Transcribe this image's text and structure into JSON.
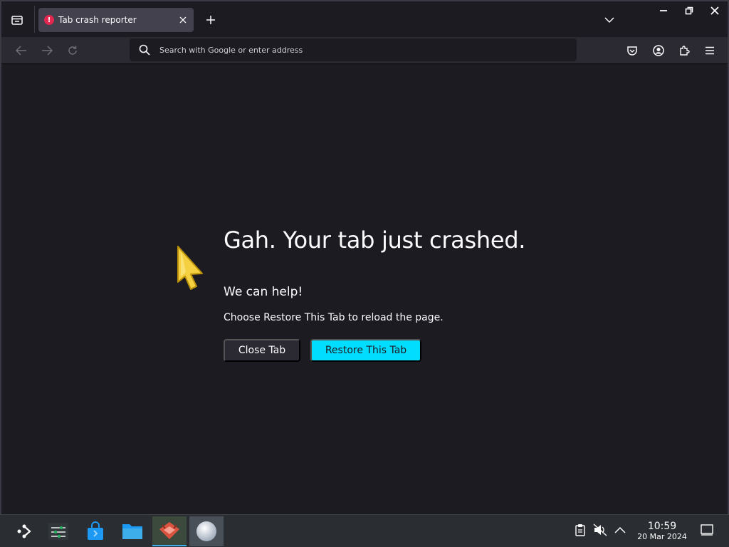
{
  "browser": {
    "tab": {
      "title": "Tab crash reporter",
      "icon": "alert-icon"
    },
    "urlbar": {
      "placeholder": "Search with Google or enter address"
    }
  },
  "crash_page": {
    "title": "Gah. Your tab just crashed.",
    "subtitle": "We can help!",
    "message": "Choose Restore This Tab to reload the page.",
    "close_label": "Close Tab",
    "restore_label": "Restore This Tab"
  },
  "colors": {
    "accent": "#00ddff",
    "background": "#1c1b22",
    "toolbar": "#2b2a33",
    "tab_active": "#42414d",
    "taskbar": "#2a2e32"
  },
  "taskbar": {
    "items": [
      "app-launcher",
      "system-settings",
      "discover-store",
      "file-manager",
      "firefox",
      "plasma-app"
    ],
    "clock": {
      "time": "10:59",
      "date": "20 Mar 2024"
    }
  }
}
